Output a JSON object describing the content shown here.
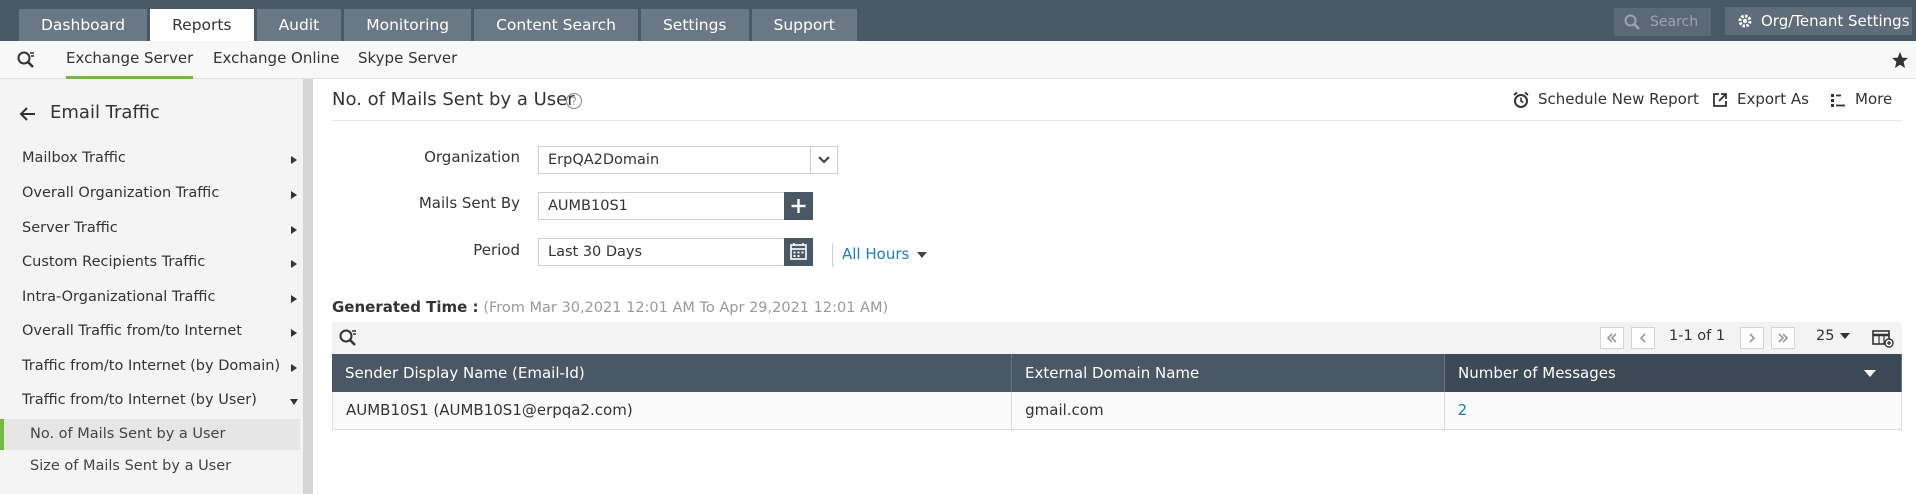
{
  "top_tabs": [
    "Dashboard",
    "Reports",
    "Audit",
    "Monitoring",
    "Content Search",
    "Settings",
    "Support"
  ],
  "active_top_tab": "Reports",
  "search_placeholder": "Search",
  "org_settings_label": "Org/Tenant Settings",
  "sub_nav": [
    "Exchange Server",
    "Exchange Online",
    "Skype Server"
  ],
  "active_sub_nav": "Exchange Server",
  "sidebar": {
    "title": "Email Traffic",
    "items": [
      "Mailbox Traffic",
      "Overall Organization Traffic",
      "Server Traffic",
      "Custom Recipients Traffic",
      "Intra-Organizational Traffic",
      "Overall Traffic from/to Internet",
      "Traffic from/to Internet (by Domain)",
      "Traffic from/to Internet (by User)"
    ],
    "sub_items": [
      "No. of Mails Sent by a User",
      "Size of Mails Sent by a User"
    ]
  },
  "report": {
    "title": "No. of Mails Sent by a User",
    "actions": [
      "Schedule New Report",
      "Export As",
      "More"
    ]
  },
  "form": {
    "organization_label": "Organization",
    "organization_value": "ErpQA2Domain",
    "mails_sent_by_label": "Mails Sent By",
    "mails_sent_by_value": "AUMB10S1",
    "period_label": "Period",
    "period_value": "Last 30 Days",
    "hours_value": "All Hours"
  },
  "generated": {
    "label": "Generated Time :",
    "range": "(From Mar 30,2021 12:01 AM To Apr 29,2021 12:01 AM)"
  },
  "pagination": {
    "text": "1-1 of 1",
    "page_size": "25"
  },
  "table": {
    "columns": [
      "Sender Display Name (Email-Id)",
      "External Domain Name",
      "Number of Messages"
    ],
    "rows": [
      [
        "AUMB10S1 (AUMB10S1@erpqa2.com)",
        "gmail.com",
        "2"
      ]
    ]
  },
  "colors": {
    "header_bg": "#4a5865",
    "accent_green": "#77b84a",
    "link_blue": "#1a7ec2"
  }
}
